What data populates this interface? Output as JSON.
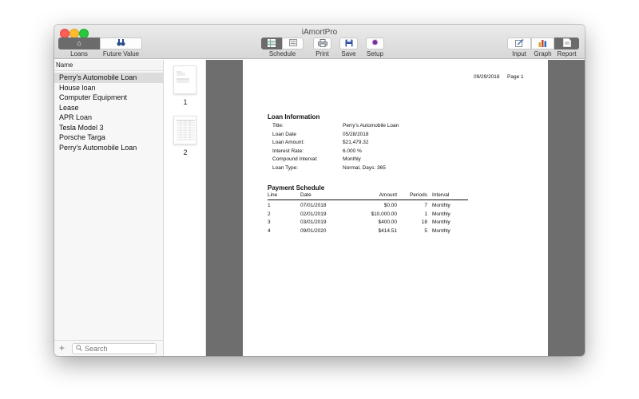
{
  "window": {
    "title": "iAmortPro"
  },
  "toolbar": {
    "loans_label": "Loans",
    "future_value_label": "Future Value",
    "schedule_label": "Schedule",
    "print_label": "Print",
    "save_label": "Save",
    "setup_label": "Setup",
    "input_label": "Input",
    "graph_label": "Graph",
    "report_label": "Report"
  },
  "sidebar": {
    "header": "Name",
    "items": [
      {
        "label": "Perry's Automobile Loan",
        "selected": true
      },
      {
        "label": "House loan"
      },
      {
        "label": "Computer Equipment"
      },
      {
        "label": "Lease"
      },
      {
        "label": "APR Loan"
      },
      {
        "label": "Tesla Model 3"
      },
      {
        "label": "Porsche Targa"
      },
      {
        "label": "Perry's Automobile Loan"
      }
    ],
    "add_label": "+",
    "search_placeholder": "Search"
  },
  "thumbnails": [
    {
      "page": "1"
    },
    {
      "page": "2"
    }
  ],
  "report": {
    "date": "09/29/2018",
    "page": "Page 1",
    "loan_info": {
      "title": "Loan Information",
      "rows": [
        {
          "label": "Title:",
          "value": "Perry's Automobile Loan"
        },
        {
          "label": "Loan Date",
          "value": "05/28/2018"
        },
        {
          "label": "Loan Amount:",
          "value": "$21,479.32"
        },
        {
          "label": "Interest Rate:",
          "value": "6.000 %"
        },
        {
          "label": "Compound Interval:",
          "value": "Monthly"
        },
        {
          "label": "Loan Type:",
          "value": "Normal, Days: 365"
        }
      ]
    },
    "schedule": {
      "title": "Payment Schedule",
      "headers": {
        "line": "Line",
        "date": "Date",
        "amount": "Amount",
        "periods": "Periods",
        "interval": "Interval"
      },
      "rows": [
        {
          "line": "1",
          "date": "07/01/2018",
          "amount": "$0.00",
          "periods": "7",
          "interval": "Monthly"
        },
        {
          "line": "2",
          "date": "02/01/2019",
          "amount": "$10,000.00",
          "periods": "1",
          "interval": "Monthly"
        },
        {
          "line": "3",
          "date": "03/01/2019",
          "amount": "$400.00",
          "periods": "18",
          "interval": "Monthly"
        },
        {
          "line": "4",
          "date": "09/01/2020",
          "amount": "$414.51",
          "periods": "5",
          "interval": "Monthly"
        }
      ]
    }
  },
  "colors": {
    "toolbar_selected": "#6b6b6b",
    "viewer_background": "#6e6e6e",
    "selection": "#dcdcdc"
  }
}
